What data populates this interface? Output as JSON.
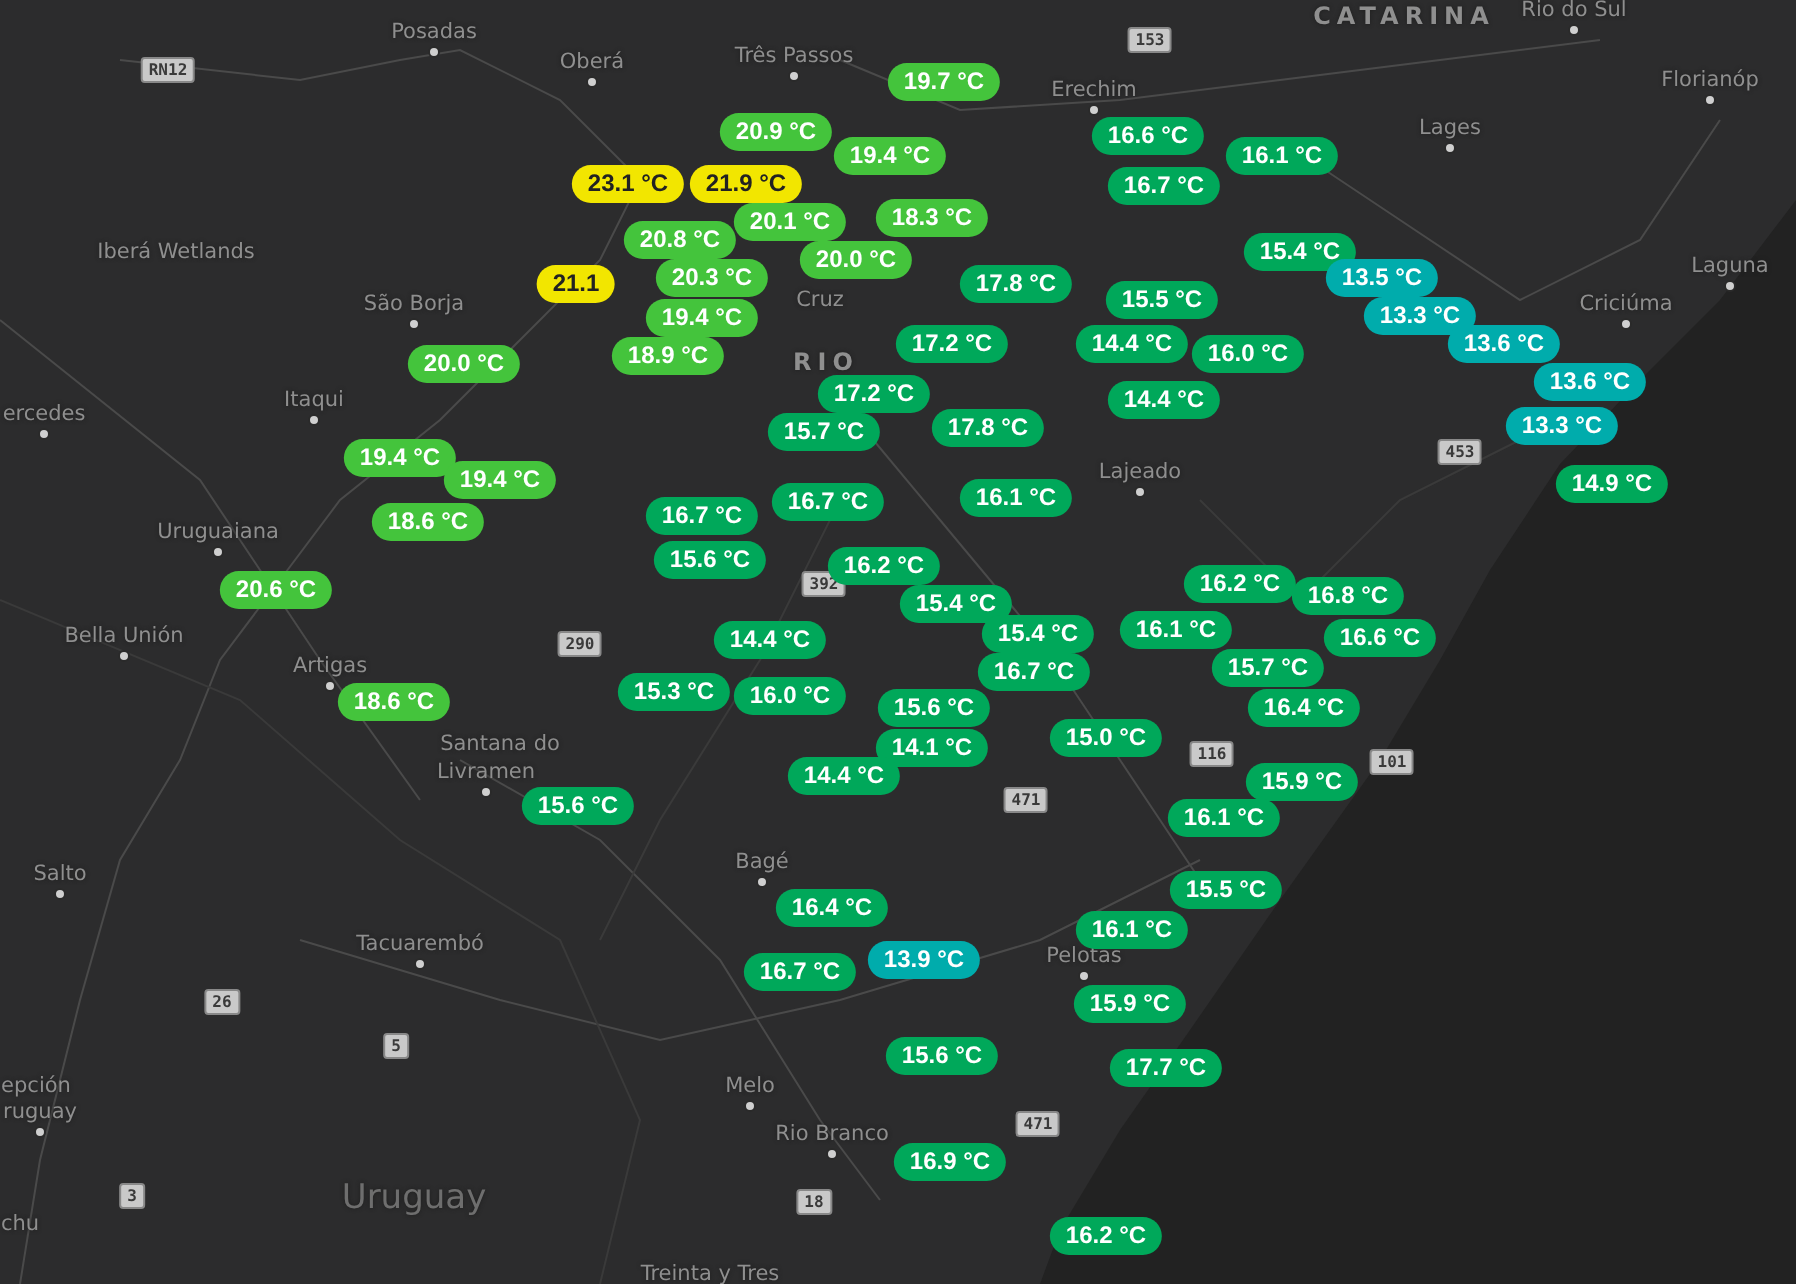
{
  "map": {
    "places": [
      {
        "name": "Posadas",
        "kind": "city"
      },
      {
        "name": "Oberá",
        "kind": "city"
      },
      {
        "name": "Três Passos",
        "kind": "city"
      },
      {
        "name": "Erechim",
        "kind": "city"
      },
      {
        "name": "CATARINA",
        "kind": "region"
      },
      {
        "name": "Rio do Sul",
        "kind": "city"
      },
      {
        "name": "Florianóp",
        "kind": "city"
      },
      {
        "name": "Lages",
        "kind": "city"
      },
      {
        "name": "Laguna",
        "kind": "city"
      },
      {
        "name": "Criciúma",
        "kind": "city"
      },
      {
        "name": "Iberá Wetlands",
        "kind": "area"
      },
      {
        "name": "São Borja",
        "kind": "city"
      },
      {
        "name": "Itaqui",
        "kind": "city"
      },
      {
        "name": "ercedes",
        "kind": "city"
      },
      {
        "name": "Uruguaiana",
        "kind": "city"
      },
      {
        "name": "Bella Unión",
        "kind": "city"
      },
      {
        "name": "Artigas",
        "kind": "city"
      },
      {
        "name": "Santana do",
        "kind": "area"
      },
      {
        "name": "Livramen",
        "kind": "city"
      },
      {
        "name": "Salto",
        "kind": "city"
      },
      {
        "name": "Tacuarembó",
        "kind": "city"
      },
      {
        "name": "epción",
        "kind": "area"
      },
      {
        "name": "ruguay",
        "kind": "city"
      },
      {
        "name": "chu",
        "kind": "area"
      },
      {
        "name": "Uruguay",
        "kind": "country"
      },
      {
        "name": "Bagé",
        "kind": "city"
      },
      {
        "name": "Melo",
        "kind": "city"
      },
      {
        "name": "Rio Branco",
        "kind": "city"
      },
      {
        "name": "Treinta y Tres",
        "kind": "area"
      },
      {
        "name": "Pelotas",
        "kind": "city"
      },
      {
        "name": "Lajeado",
        "kind": "city"
      },
      {
        "name": "Cruz",
        "kind": "area"
      },
      {
        "name": "RIO",
        "kind": "region"
      }
    ],
    "road_shields": [
      {
        "label": "RN12"
      },
      {
        "label": "153"
      },
      {
        "label": "453"
      },
      {
        "label": "392"
      },
      {
        "label": "290"
      },
      {
        "label": "116"
      },
      {
        "label": "101"
      },
      {
        "label": "471"
      },
      {
        "label": "26"
      },
      {
        "label": "5"
      },
      {
        "label": "3"
      },
      {
        "label": "18"
      },
      {
        "label": "471"
      }
    ],
    "readings": [
      {
        "value": "19.7 °C",
        "color": "#44c43c"
      },
      {
        "value": "20.9 °C",
        "color": "#44c43c"
      },
      {
        "value": "23.1 °C",
        "color": "#f2e600"
      },
      {
        "value": "21.9 °C",
        "color": "#f2e600"
      },
      {
        "value": "19.4 °C",
        "color": "#44c43c"
      },
      {
        "value": "18.3 °C",
        "color": "#44c43c"
      },
      {
        "value": "20.1 °C",
        "color": "#44c43c"
      },
      {
        "value": "20.8 °C",
        "color": "#44c43c"
      },
      {
        "value": "20.0 °C",
        "color": "#44c43c"
      },
      {
        "value": "21.1",
        "color": "#f2e600"
      },
      {
        "value": "20.3 °C",
        "color": "#44c43c"
      },
      {
        "value": "19.4 °C",
        "color": "#44c43c"
      },
      {
        "value": "18.9 °C",
        "color": "#44c43c"
      },
      {
        "value": "20.0 °C",
        "color": "#44c43c"
      },
      {
        "value": "19.4 °C",
        "color": "#44c43c"
      },
      {
        "value": "19.4 °C",
        "color": "#44c43c"
      },
      {
        "value": "18.6 °C",
        "color": "#44c43c"
      },
      {
        "value": "20.6 °C",
        "color": "#44c43c"
      },
      {
        "value": "18.6 °C",
        "color": "#44c43c"
      },
      {
        "value": "16.6 °C",
        "color": "#00a85a"
      },
      {
        "value": "16.1 °C",
        "color": "#00a85a"
      },
      {
        "value": "16.7 °C",
        "color": "#00a85a"
      },
      {
        "value": "17.8 °C",
        "color": "#00a85a"
      },
      {
        "value": "15.5 °C",
        "color": "#00a85a"
      },
      {
        "value": "15.4 °C",
        "color": "#00a85a"
      },
      {
        "value": "13.5 °C",
        "color": "#00acac"
      },
      {
        "value": "13.3 °C",
        "color": "#00acac"
      },
      {
        "value": "13.6 °C",
        "color": "#00acac"
      },
      {
        "value": "13.6 °C",
        "color": "#00acac"
      },
      {
        "value": "13.3 °C",
        "color": "#00acac"
      },
      {
        "value": "14.9 °C",
        "color": "#00a85a"
      },
      {
        "value": "17.2 °C",
        "color": "#00a85a"
      },
      {
        "value": "14.4 °C",
        "color": "#00a85a"
      },
      {
        "value": "16.0 °C",
        "color": "#00a85a"
      },
      {
        "value": "17.2 °C",
        "color": "#00a85a"
      },
      {
        "value": "17.8 °C",
        "color": "#00a85a"
      },
      {
        "value": "14.4 °C",
        "color": "#00a85a"
      },
      {
        "value": "15.7 °C",
        "color": "#00a85a"
      },
      {
        "value": "16.1 °C",
        "color": "#00a85a"
      },
      {
        "value": "16.7 °C",
        "color": "#00a85a"
      },
      {
        "value": "16.7 °C",
        "color": "#00a85a"
      },
      {
        "value": "15.6 °C",
        "color": "#00a85a"
      },
      {
        "value": "16.2 °C",
        "color": "#00a85a"
      },
      {
        "value": "15.4 °C",
        "color": "#00a85a"
      },
      {
        "value": "15.4 °C",
        "color": "#00a85a"
      },
      {
        "value": "16.7 °C",
        "color": "#00a85a"
      },
      {
        "value": "16.1 °C",
        "color": "#00a85a"
      },
      {
        "value": "16.2 °C",
        "color": "#00a85a"
      },
      {
        "value": "16.8 °C",
        "color": "#00a85a"
      },
      {
        "value": "15.7 °C",
        "color": "#00a85a"
      },
      {
        "value": "16.6 °C",
        "color": "#00a85a"
      },
      {
        "value": "16.4 °C",
        "color": "#00a85a"
      },
      {
        "value": "14.4 °C",
        "color": "#00a85a"
      },
      {
        "value": "15.3 °C",
        "color": "#00a85a"
      },
      {
        "value": "16.0 °C",
        "color": "#00a85a"
      },
      {
        "value": "15.6 °C",
        "color": "#00a85a"
      },
      {
        "value": "14.1 °C",
        "color": "#00a85a"
      },
      {
        "value": "15.0 °C",
        "color": "#00a85a"
      },
      {
        "value": "14.4 °C",
        "color": "#00a85a"
      },
      {
        "value": "15.6 °C",
        "color": "#00a85a"
      },
      {
        "value": "15.9 °C",
        "color": "#00a85a"
      },
      {
        "value": "16.1 °C",
        "color": "#00a85a"
      },
      {
        "value": "15.5 °C",
        "color": "#00a85a"
      },
      {
        "value": "16.1 °C",
        "color": "#00a85a"
      },
      {
        "value": "16.4 °C",
        "color": "#00a85a"
      },
      {
        "value": "16.7 °C",
        "color": "#00a85a"
      },
      {
        "value": "13.9 °C",
        "color": "#00acac"
      },
      {
        "value": "15.9 °C",
        "color": "#00a85a"
      },
      {
        "value": "15.6 °C",
        "color": "#00a85a"
      },
      {
        "value": "17.7 °C",
        "color": "#00a85a"
      },
      {
        "value": "16.9 °C",
        "color": "#00a85a"
      },
      {
        "value": "16.2 °C",
        "color": "#00a85a"
      }
    ]
  }
}
